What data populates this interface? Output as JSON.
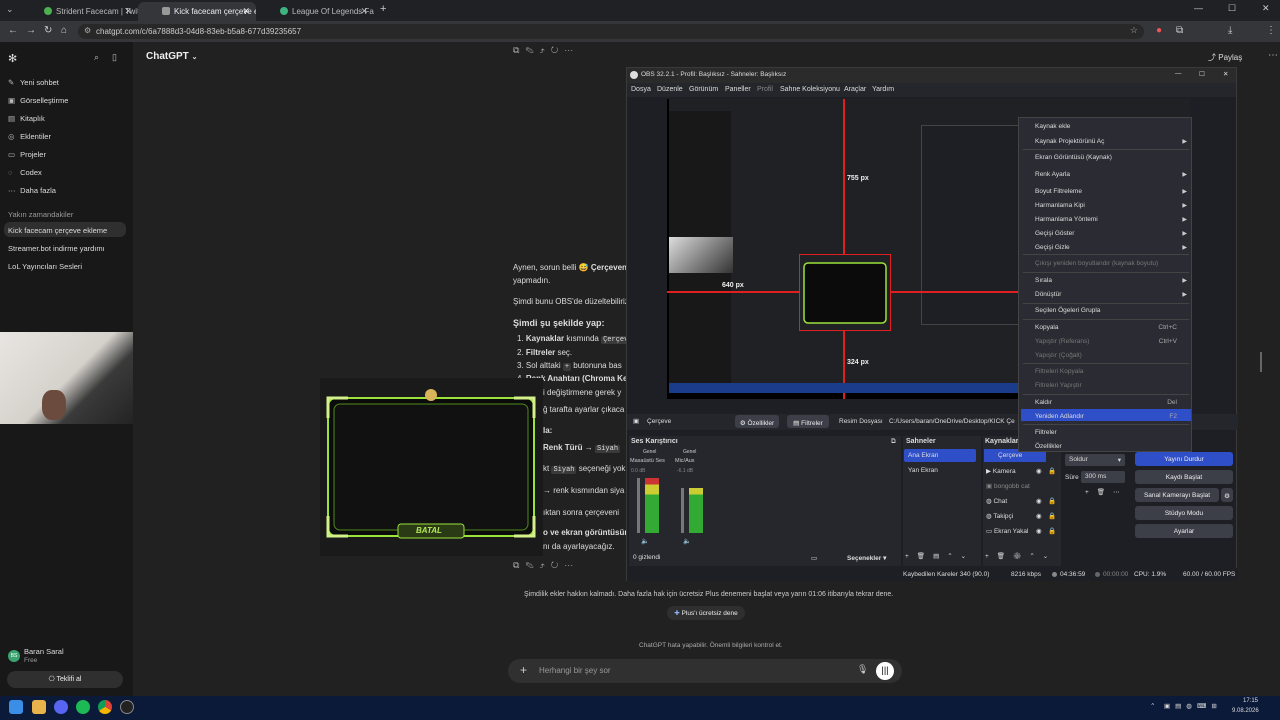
{
  "browser": {
    "tabs": [
      {
        "title": "Strident Facecam | Twitch and"
      },
      {
        "title": "Kick facecam çerçeve ekleme"
      },
      {
        "title": "League Of Legends Facecam Fr"
      }
    ],
    "new_tab": "+",
    "url": "chatgpt.com/c/6a7888d3-04d8-83eb-b5a8-677d39235657"
  },
  "sidebar": {
    "items": [
      "Yeni sohbet",
      "Görselleştirme",
      "Kitaplık",
      "Eklentiler",
      "Projeler",
      "Codex",
      "Daha fazla"
    ],
    "recent_header": "Yakın zamandakiler",
    "recent": [
      "Kick facecam çerçeve ekleme",
      "Streamer.bot indirme yardımı",
      "LoL Yayıncıları Sesleri"
    ],
    "user_name": "Baran Saral",
    "user_plan": "Free",
    "offer_button": "Teklifi al"
  },
  "header": {
    "model": "ChatGPT",
    "share": "Paylaş"
  },
  "chat": {
    "line1a": "Aynen, sorun belli 😅",
    "line1b": "Çerçeveni",
    "line2": "yapmadın.",
    "line3": "Şimdi bunu OBS'de düzeltebiliriz",
    "heading": "Şimdi şu şekilde yap:",
    "steps": [
      {
        "num": "1.",
        "bold": "Kaynaklar",
        "rest": "kısmında",
        "code": "Çerçeve"
      },
      {
        "num": "2.",
        "bold": "Filtreler",
        "rest": "seç.",
        "code": ""
      },
      {
        "num": "3.",
        "bold": "",
        "rest": "Sol alttaki",
        "code": "+",
        "rest2": "butonuna bas"
      },
      {
        "num": "4.",
        "bold": "Renk Anahtarı (Chroma Key",
        "rest": "",
        "code": ""
      }
    ],
    "frag1": "i değiştirmene gerek y",
    "frag2": "ğ tarafta ayarlar çıkaca",
    "frag3": "la:",
    "frag4a": "Renk Türü →",
    "frag4code": "Siyah",
    "frag5a": "kt",
    "frag5code": "Siyah",
    "frag5b": "seçeneği yok",
    "frag6": "→ renk kısmından siya",
    "frag7": "ıktan sonra çerçeveni",
    "frag8": "o ve ekran görüntüsünü",
    "frag9": "nı da ayarlayacağız.",
    "frame_label": "BATAL",
    "limit_text": "Şimdilik ekler hakkın kalmadı. Daha fazla hak için ücretsiz Plus denemeni başlat veya yarın 01:06 itibarıyla tekrar dene.",
    "plus_button": "Plus'ı ücretsiz dene",
    "disclaimer": "ChatGPT hata yapabilir. Önemli bilgileri kontrol et.",
    "input_placeholder": "Herhangi bir şey sor"
  },
  "obs": {
    "title": "OBS 32.2.1 - Profil: Başlıksız - Sahneler: Başlıksız",
    "menu": [
      "Dosya",
      "Düzenle",
      "Görünüm",
      "Paneller",
      "Profil",
      "Sahne Koleksiyonu",
      "Araçlar",
      "Yardım"
    ],
    "measurements": {
      "top": "755 px",
      "left": "640 px",
      "bottom": "324 px"
    },
    "source_bar": {
      "name": "Çerçeve",
      "properties": "Özellikler",
      "filters": "Filtreler",
      "image_file": "Resim Dosyası",
      "path": "C:/Users/baran/OneDrive/Desktop/KICK Çe"
    },
    "audio_title": "Ses Karıştırıcı",
    "audio_channels": [
      {
        "tag": "Genel",
        "name": "Masaüstü Ses",
        "db": "0.0 dB"
      },
      {
        "tag": "Genel",
        "name": "Mic/Aux",
        "db": "-6.1 dB"
      }
    ],
    "hidden_count": "0 gizlendi",
    "options_button": "Seçenekler",
    "scenes_title": "Sahneler",
    "scenes": [
      "Ana Ekran",
      "Yan Ekran"
    ],
    "sources_title": "Kaynaklar",
    "sources": [
      "Çerçeve",
      "Kamera",
      "bongobb cat",
      "Chat",
      "Takipçi",
      "Ekran Yakal"
    ],
    "transition_name": "Soldur",
    "duration_label": "Süre",
    "duration_value": "300 ms",
    "controls": [
      "Yayını Durdur",
      "Kaydı Başlat",
      "Sanal Kamerayı Başlat",
      "Stüdyo Modu",
      "Ayarlar"
    ],
    "status": {
      "dropped": "Kaybedilen Kareler 340 (90.0)",
      "bitrate": "8216 kbps",
      "stream_time": "04:36:59",
      "rec_time": "00:00:00",
      "cpu": "CPU: 1.9%",
      "fps": "60.00 / 60.00 FPS"
    },
    "context_menu": [
      {
        "label": "Kaynak ekle",
        "disabled": false,
        "arrow": false,
        "shortcut": ""
      },
      {
        "label": "Kaynak Projektörünü Aç",
        "disabled": false,
        "arrow": true,
        "shortcut": ""
      },
      {
        "label": "Ekran Görüntüsü (Kaynak)",
        "disabled": false,
        "arrow": false,
        "shortcut": ""
      },
      {
        "label": "Renk Ayarla",
        "disabled": false,
        "arrow": true,
        "shortcut": ""
      },
      {
        "label": "Boyut Filtreleme",
        "disabled": false,
        "arrow": true,
        "shortcut": ""
      },
      {
        "label": "Harmanlama Kipi",
        "disabled": false,
        "arrow": true,
        "shortcut": ""
      },
      {
        "label": "Harmanlama Yöntemi",
        "disabled": false,
        "arrow": true,
        "shortcut": ""
      },
      {
        "label": "Geçişi Göster",
        "disabled": false,
        "arrow": true,
        "shortcut": ""
      },
      {
        "label": "Geçişi Gizle",
        "disabled": false,
        "arrow": true,
        "shortcut": ""
      },
      {
        "label": "Çıkışı yeniden boyutlandır (kaynak boyutu)",
        "disabled": true,
        "arrow": false,
        "shortcut": ""
      },
      {
        "label": "Sırala",
        "disabled": false,
        "arrow": true,
        "shortcut": ""
      },
      {
        "label": "Dönüştür",
        "disabled": false,
        "arrow": true,
        "shortcut": ""
      },
      {
        "label": "Seçilen Ögeleri Grupla",
        "disabled": false,
        "arrow": false,
        "shortcut": ""
      },
      {
        "label": "Kopyala",
        "disabled": false,
        "arrow": false,
        "shortcut": "Ctrl+C"
      },
      {
        "label": "Yapıştır (Referans)",
        "disabled": true,
        "arrow": false,
        "shortcut": "Ctrl+V"
      },
      {
        "label": "Yapıştır (Çoğalt)",
        "disabled": true,
        "arrow": false,
        "shortcut": ""
      },
      {
        "label": "Filtreleri Kopyala",
        "disabled": true,
        "arrow": false,
        "shortcut": ""
      },
      {
        "label": "Filtreleri Yapıştır",
        "disabled": true,
        "arrow": false,
        "shortcut": ""
      },
      {
        "label": "Kaldır",
        "disabled": false,
        "arrow": false,
        "shortcut": "Del"
      },
      {
        "label": "Yeniden Adlandır",
        "disabled": false,
        "arrow": false,
        "shortcut": "F2"
      },
      {
        "label": "Filtreler",
        "disabled": false,
        "arrow": false,
        "shortcut": ""
      },
      {
        "label": "Özellikler",
        "disabled": false,
        "arrow": false,
        "shortcut": ""
      }
    ]
  },
  "taskbar": {
    "time": "17:15",
    "date": "9.08.2026"
  },
  "colors": {
    "accent_red": "#e02020",
    "frame_green": "#9be23a",
    "highlight": "#2f4fc9"
  }
}
